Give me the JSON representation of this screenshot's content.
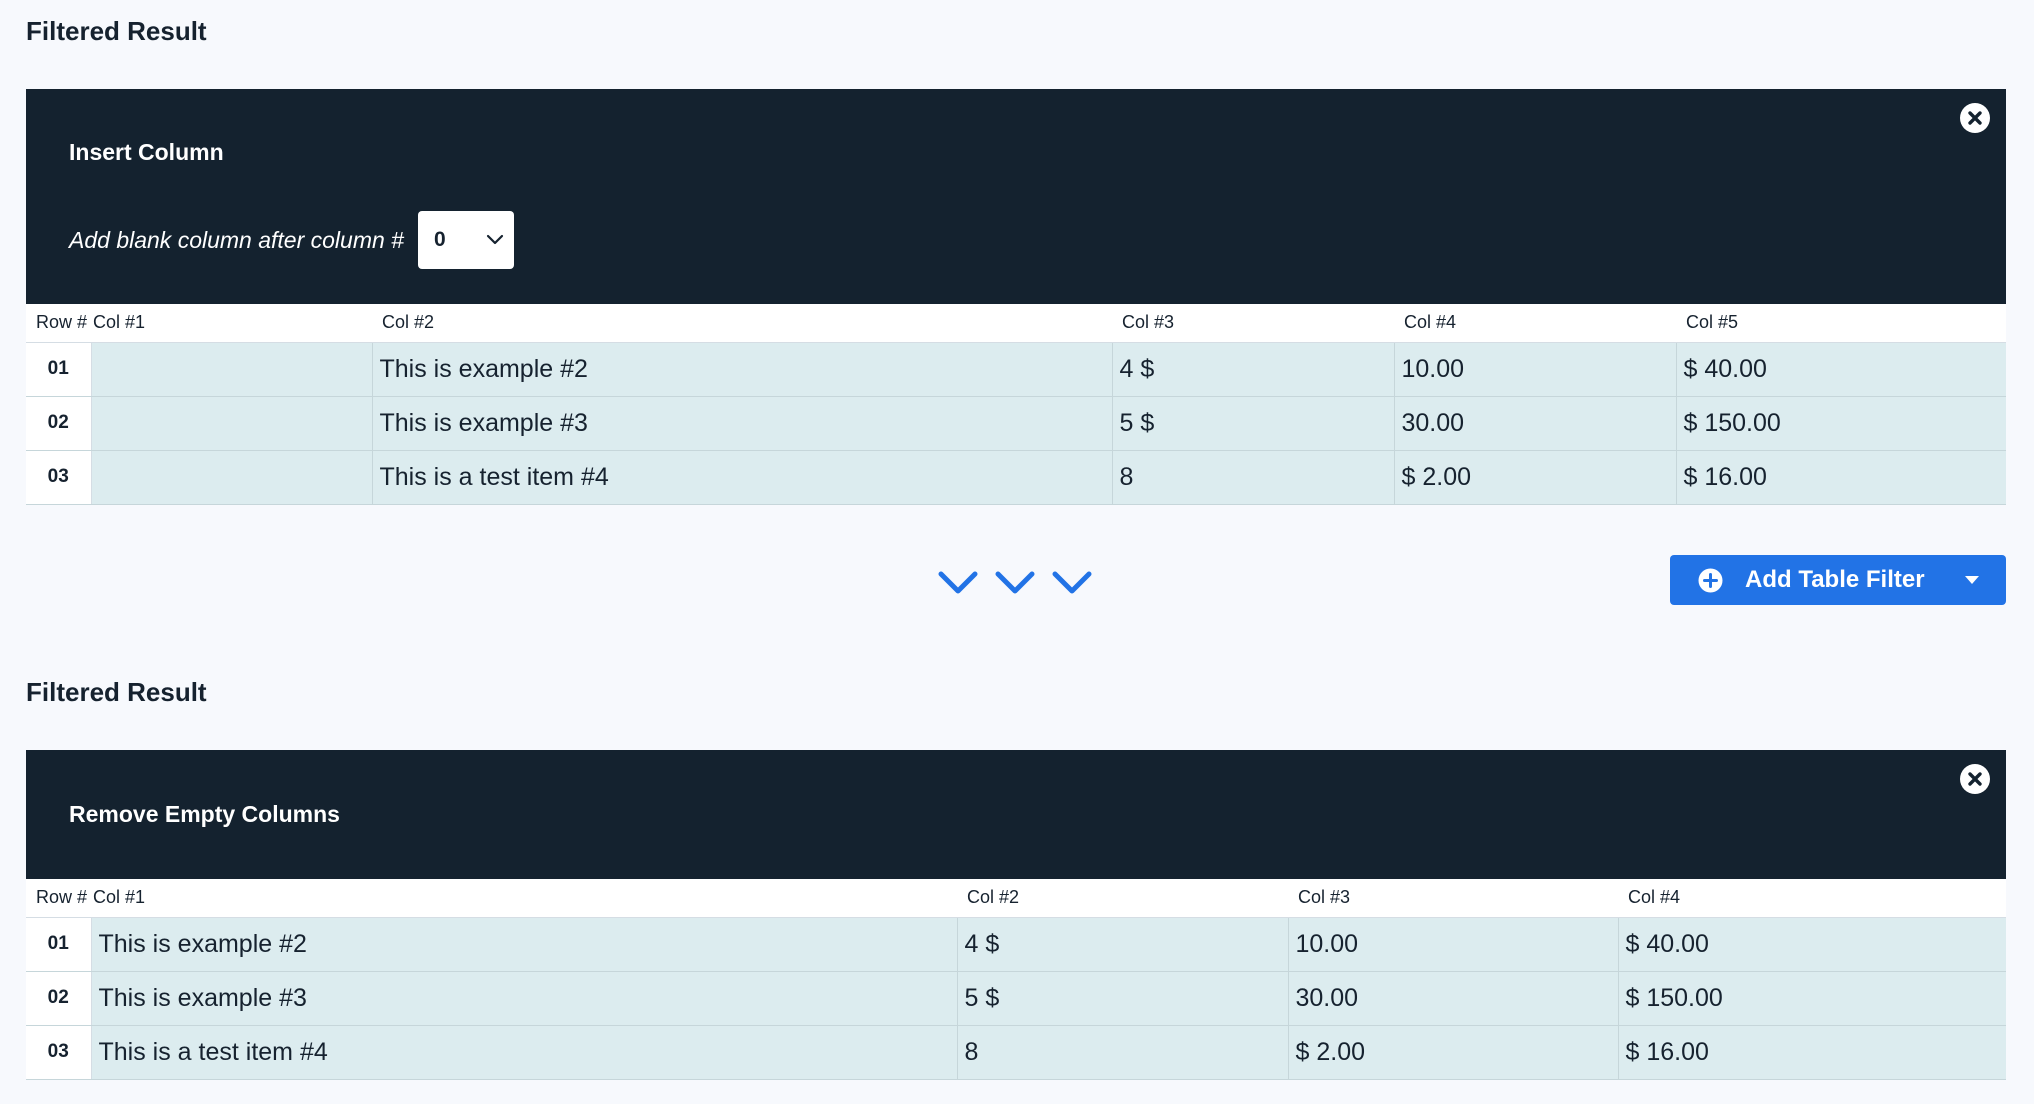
{
  "section1": {
    "title": "Filtered Result",
    "panel_title": "Insert Column",
    "insert_label": "Add blank column after column #",
    "insert_select_value": "0",
    "table": {
      "headers": [
        "Row #",
        "Col #1",
        "Col #2",
        "Col #3",
        "Col #4",
        "Col #5"
      ],
      "rows": [
        [
          "01",
          "",
          "This is example #2",
          "4 $",
          "10.00",
          "$ 40.00"
        ],
        [
          "02",
          "",
          "This is example #3",
          "5 $",
          "30.00",
          "$ 150.00"
        ],
        [
          "03",
          "",
          "This is a test item #4",
          "8",
          "$ 2.00",
          "$ 16.00"
        ]
      ]
    }
  },
  "actions": {
    "add_filter_label": "Add Table Filter"
  },
  "section2": {
    "title": "Filtered Result",
    "panel_title": "Remove Empty Columns",
    "table": {
      "headers": [
        "Row #",
        "Col #1",
        "Col #2",
        "Col #3",
        "Col #4"
      ],
      "rows": [
        [
          "01",
          "This is example #2",
          "4 $",
          "10.00",
          "$ 40.00"
        ],
        [
          "02",
          "This is example #3",
          "5 $",
          "30.00",
          "$ 150.00"
        ],
        [
          "03",
          "This is a test item #4",
          "8",
          "$ 2.00",
          "$ 16.00"
        ]
      ]
    }
  },
  "icons": {
    "close": "close-circle-icon",
    "select_chevron": "chevron-down-icon",
    "flow_chevrons": "chevron-down-icon",
    "add": "plus-circle-icon",
    "dropdown": "caret-down-icon"
  },
  "colors": {
    "panel_bg": "#14222f",
    "row_bg": "#dcecef",
    "accent": "#2273e6",
    "page_bg": "#f7f9fd"
  }
}
